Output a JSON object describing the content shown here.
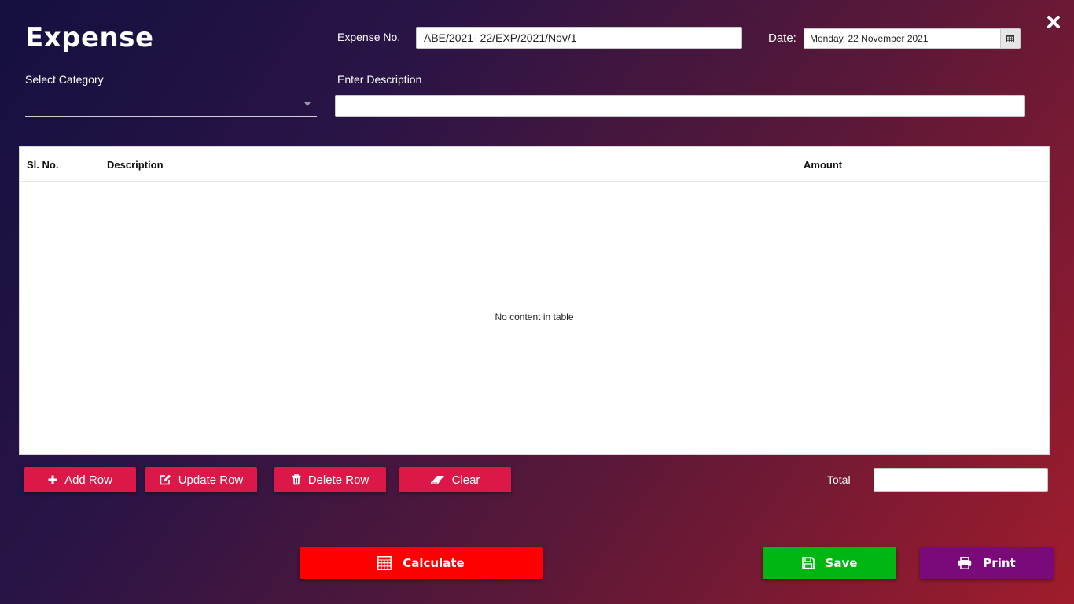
{
  "page": {
    "title": "Expense"
  },
  "form": {
    "expense_no_label": "Expense No.",
    "expense_no_value": "ABE/2021- 22/EXP/2021/Nov/1",
    "date_label": "Date:",
    "date_value": "Monday, 22 November 2021",
    "category_label": "Select Category",
    "category_value": "",
    "description_label": "Enter Description",
    "description_value": ""
  },
  "table": {
    "columns": [
      "Sl. No.",
      "Description",
      "Amount"
    ],
    "rows": [],
    "empty_text": "No content in table"
  },
  "row_actions": {
    "add": "Add Row",
    "update": "Update Row",
    "delete": "Delete Row",
    "clear": "Clear"
  },
  "total": {
    "label": "Total",
    "value": ""
  },
  "actions": {
    "calculate": "Calculate",
    "save": "Save",
    "print": "Print"
  },
  "icons": {
    "close": "close-icon",
    "calendar": "calendar-icon",
    "dropdown": "chevron-down-icon",
    "add": "plus-icon",
    "update": "edit-icon",
    "delete": "trash-icon",
    "clear": "eraser-icon",
    "calculate": "calculator-icon",
    "save": "floppy-disk-icon",
    "print": "printer-icon"
  },
  "colors": {
    "row_button": "#dc1848",
    "calculate": "#ff0000",
    "save": "#00b612",
    "print": "#7a0a7a"
  }
}
